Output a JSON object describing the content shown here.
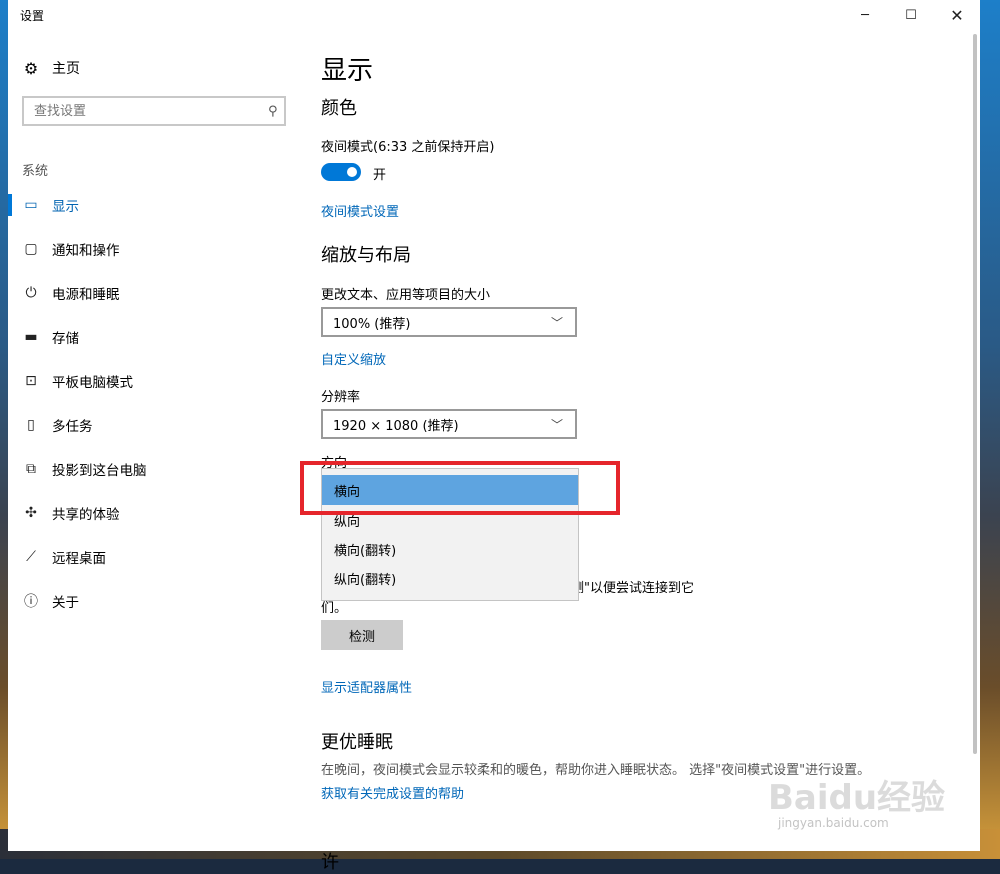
{
  "window": {
    "title": "设置",
    "controls": {
      "minimize": "─",
      "maximize": "☐",
      "close": "✕"
    }
  },
  "sidebar": {
    "home": {
      "icon": "gear-icon",
      "glyph": "⚙",
      "label": "主页"
    },
    "search": {
      "placeholder": "查找设置",
      "icon": "search-icon",
      "glyph": "⚲"
    },
    "section": "系统",
    "items": [
      {
        "name": "display",
        "icon": "monitor-icon",
        "glyph": "▭",
        "label": "显示",
        "active": true
      },
      {
        "name": "notifications",
        "icon": "notification-icon",
        "glyph": "▢",
        "label": "通知和操作"
      },
      {
        "name": "power",
        "icon": "power-icon",
        "glyph": "⏻",
        "label": "电源和睡眠"
      },
      {
        "name": "storage",
        "icon": "storage-icon",
        "glyph": "▬",
        "label": "存储"
      },
      {
        "name": "tablet",
        "icon": "tablet-icon",
        "glyph": "⊡",
        "label": "平板电脑模式"
      },
      {
        "name": "multitask",
        "icon": "multitask-icon",
        "glyph": "▯",
        "label": "多任务"
      },
      {
        "name": "project",
        "icon": "project-icon",
        "glyph": "⧉",
        "label": "投影到这台电脑"
      },
      {
        "name": "shared",
        "icon": "share-icon",
        "glyph": "✣",
        "label": "共享的体验"
      },
      {
        "name": "remote",
        "icon": "remote-desktop-icon",
        "glyph": "⟋",
        "label": "远程桌面"
      },
      {
        "name": "about",
        "icon": "info-icon",
        "glyph": "ⓘ",
        "label": "关于"
      }
    ]
  },
  "main": {
    "page_title": "显示",
    "color": {
      "heading": "颜色",
      "night_mode_label": "夜间模式(6:33 之前保持开启)",
      "toggle_state": "开",
      "night_mode_link": "夜间模式设置"
    },
    "scale": {
      "heading": "缩放与布局",
      "size_label": "更改文本、应用等项目的大小",
      "size_value": "100% (推荐)",
      "custom_scale_link": "自定义缩放",
      "resolution_label": "分辨率",
      "resolution_value": "1920 × 1080 (推荐)",
      "orientation_label": "方向",
      "orientation_options": [
        "横向",
        "纵向",
        "横向(翻转)",
        "纵向(翻转)"
      ]
    },
    "detect": {
      "text_tail": "择\"检测\"以便尝试连接到它",
      "text_line2": "们。",
      "button": "检测"
    },
    "adapter_link": "显示适配器属性",
    "sleep": {
      "heading": "更优睡眠",
      "desc": "在晚间，夜间模式会显示较柔和的暖色，帮助你进入睡眠状态。 选择\"夜间模式设置\"进行设置。",
      "help_link": "获取有关完成设置的帮助"
    },
    "cutoff_heading": "许"
  },
  "watermark": {
    "main": "Baidu经验",
    "sub": "jingyan.baidu.com"
  }
}
